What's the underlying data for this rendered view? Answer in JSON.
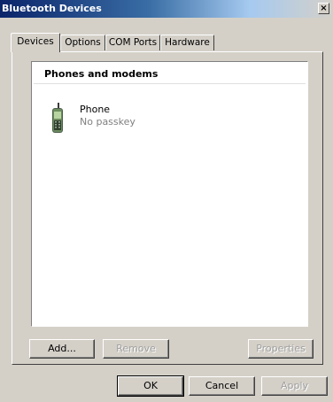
{
  "window": {
    "title": "Bluetooth Devices",
    "close_label": "×"
  },
  "tabs": [
    {
      "label": "Devices",
      "active": true
    },
    {
      "label": "Options",
      "active": false
    },
    {
      "label": "COM Ports",
      "active": false
    },
    {
      "label": "Hardware",
      "active": false
    }
  ],
  "devices_panel": {
    "group_header": "Phones and modems",
    "devices": [
      {
        "name": "Phone",
        "status": "No passkey",
        "icon": "mobile-phone-icon"
      }
    ],
    "buttons": {
      "add": "Add...",
      "remove": "Remove",
      "properties": "Properties"
    }
  },
  "dialog_buttons": {
    "ok": "OK",
    "cancel": "Cancel",
    "apply": "Apply"
  }
}
